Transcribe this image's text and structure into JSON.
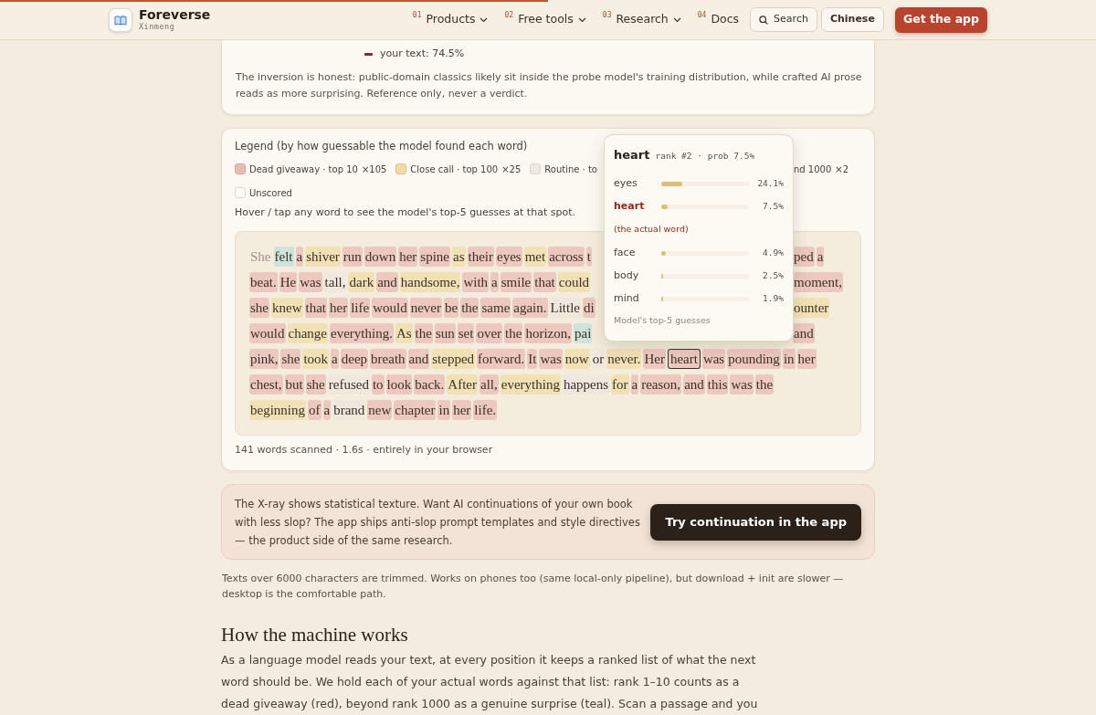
{
  "progress": {
    "level": 0.5
  },
  "header": {
    "brand": {
      "name": "Foreverse",
      "subtitle": "Xinmeng"
    },
    "nav": [
      {
        "number": "01",
        "label": "Products",
        "dropdown": true
      },
      {
        "number": "02",
        "label": "Free tools",
        "dropdown": true
      },
      {
        "number": "03",
        "label": "Research",
        "dropdown": true
      },
      {
        "number": "04",
        "label": "Docs",
        "dropdown": false
      }
    ],
    "search": "Search",
    "language": "Chinese",
    "cta": "Get the app"
  },
  "summary": {
    "series_label": "your text: 74.5%",
    "note": "The inversion is honest: public-domain classics likely sit inside the probe model's training distribution, while crafted AI prose reads as more surprising. Reference only, never a verdict."
  },
  "xray": {
    "legend_title": "Legend (by how guessable the model found each word)",
    "legend_left": [
      {
        "kind": "giveaway",
        "label": "Dead giveaway · top 10",
        "count": "×105"
      },
      {
        "kind": "close",
        "label": "Close call · top 100",
        "count": "×25"
      },
      {
        "kind": "routine",
        "label": "Routine · to"
      }
    ],
    "legend_right": [
      {
        "label": "nd 1000",
        "count": "×2"
      }
    ],
    "legend_extra": [
      {
        "kind": "unscored",
        "label": "Unscored"
      }
    ],
    "hint": "Hover / tap any word to see the model's top-5 guesses at that spot.",
    "passage": [
      {
        "left": [
          {
            "text": "She",
            "kind": "unscored",
            "selected": false
          },
          {
            "text": "felt",
            "kind": "surprise",
            "selected": false
          },
          {
            "text": "a",
            "kind": "giveaway",
            "selected": false
          },
          {
            "text": "shiver",
            "kind": "close",
            "selected": false
          },
          {
            "text": "run",
            "kind": "giveaway",
            "selected": false
          },
          {
            "text": "down",
            "kind": "giveaway",
            "selected": false
          },
          {
            "text": "her",
            "kind": "giveaway",
            "selected": false
          },
          {
            "text": "spine",
            "kind": "giveaway",
            "selected": false
          },
          {
            "text": "as",
            "kind": "close",
            "selected": false
          },
          {
            "text": "their",
            "kind": "giveaway",
            "selected": false
          },
          {
            "text": "eyes",
            "kind": "giveaway",
            "selected": false
          },
          {
            "text": "met",
            "kind": "close",
            "selected": false
          },
          {
            "text": "across",
            "kind": "giveaway",
            "selected": false
          },
          {
            "text": "t",
            "kind": "giveaway",
            "selected": false
          }
        ],
        "right": [
          {
            "text": "ped",
            "kind": "giveaway",
            "selected": false
          },
          {
            "text": "a",
            "kind": "giveaway",
            "selected": false
          }
        ]
      },
      {
        "left": [
          {
            "text": "beat.",
            "kind": "giveaway",
            "selected": false
          },
          {
            "text": "He",
            "kind": "giveaway",
            "selected": false
          },
          {
            "text": "was",
            "kind": "giveaway",
            "selected": false
          },
          {
            "text": "tall,",
            "kind": "routine",
            "selected": false
          },
          {
            "text": "dark",
            "kind": "close",
            "selected": false
          },
          {
            "text": "and",
            "kind": "giveaway",
            "selected": false
          },
          {
            "text": "handsome,",
            "kind": "close",
            "selected": false
          },
          {
            "text": "with",
            "kind": "giveaway",
            "selected": false
          },
          {
            "text": "a",
            "kind": "giveaway",
            "selected": false
          },
          {
            "text": "smile",
            "kind": "giveaway",
            "selected": false
          },
          {
            "text": "that",
            "kind": "giveaway",
            "selected": false
          },
          {
            "text": "could",
            "kind": "close",
            "selected": false
          }
        ],
        "right": [
          {
            "text": "moment,",
            "kind": "giveaway",
            "selected": false
          }
        ]
      },
      {
        "left": [
          {
            "text": "she",
            "kind": "giveaway",
            "selected": false
          },
          {
            "text": "knew",
            "kind": "close",
            "selected": false
          },
          {
            "text": "that",
            "kind": "giveaway",
            "selected": false
          },
          {
            "text": "her",
            "kind": "giveaway",
            "selected": false
          },
          {
            "text": "life",
            "kind": "giveaway",
            "selected": false
          },
          {
            "text": "would",
            "kind": "giveaway",
            "selected": false
          },
          {
            "text": "never",
            "kind": "giveaway",
            "selected": false
          },
          {
            "text": "be",
            "kind": "giveaway",
            "selected": false
          },
          {
            "text": "the",
            "kind": "giveaway",
            "selected": false
          },
          {
            "text": "same",
            "kind": "giveaway",
            "selected": false
          },
          {
            "text": "again.",
            "kind": "giveaway",
            "selected": false
          },
          {
            "text": "Little",
            "kind": "routine",
            "selected": false
          },
          {
            "text": "di",
            "kind": "giveaway",
            "selected": false
          }
        ],
        "right": [
          {
            "text": "ounter",
            "kind": "close",
            "selected": false
          }
        ]
      },
      {
        "left": [
          {
            "text": "would",
            "kind": "giveaway",
            "selected": false
          },
          {
            "text": "change",
            "kind": "close",
            "selected": false
          },
          {
            "text": "everything.",
            "kind": "giveaway",
            "selected": false
          },
          {
            "text": "As",
            "kind": "close",
            "selected": false
          },
          {
            "text": "the",
            "kind": "giveaway",
            "selected": false
          },
          {
            "text": "sun",
            "kind": "giveaway",
            "selected": false
          },
          {
            "text": "set",
            "kind": "giveaway",
            "selected": false
          },
          {
            "text": "over",
            "kind": "giveaway",
            "selected": false
          },
          {
            "text": "the",
            "kind": "giveaway",
            "selected": false
          },
          {
            "text": "horizon,",
            "kind": "giveaway",
            "selected": false
          },
          {
            "text": "pai",
            "kind": "surprise",
            "selected": false
          }
        ],
        "right": [
          {
            "text": "and",
            "kind": "giveaway",
            "selected": false
          }
        ]
      },
      {
        "left": [
          {
            "text": "pink,",
            "kind": "giveaway",
            "selected": false
          },
          {
            "text": "she",
            "kind": "giveaway",
            "selected": false
          },
          {
            "text": "took",
            "kind": "close",
            "selected": false
          },
          {
            "text": "a",
            "kind": "giveaway",
            "selected": false
          },
          {
            "text": "deep",
            "kind": "giveaway",
            "selected": false
          },
          {
            "text": "breath",
            "kind": "giveaway",
            "selected": false
          },
          {
            "text": "and",
            "kind": "giveaway",
            "selected": false
          },
          {
            "text": "stepped",
            "kind": "close",
            "selected": false
          },
          {
            "text": "forward.",
            "kind": "giveaway",
            "selected": false
          },
          {
            "text": "It",
            "kind": "giveaway",
            "selected": false
          },
          {
            "text": "was",
            "kind": "giveaway",
            "selected": false
          },
          {
            "text": "now",
            "kind": "close",
            "selected": false
          },
          {
            "text": "or",
            "kind": "routine",
            "selected": false
          },
          {
            "text": "never.",
            "kind": "close",
            "selected": false
          },
          {
            "text": "Her",
            "kind": "giveaway",
            "selected": false
          },
          {
            "text": "heart",
            "kind": "giveaway",
            "selected": true
          },
          {
            "text": "was",
            "kind": "giveaway",
            "selected": false
          },
          {
            "text": "pounding",
            "kind": "giveaway",
            "selected": false
          },
          {
            "text": "in",
            "kind": "giveaway",
            "selected": false
          },
          {
            "text": "her",
            "kind": "giveaway",
            "selected": false
          }
        ]
      },
      {
        "left": [
          {
            "text": "chest,",
            "kind": "giveaway",
            "selected": false
          },
          {
            "text": "but",
            "kind": "giveaway",
            "selected": false
          },
          {
            "text": "she",
            "kind": "giveaway",
            "selected": false
          },
          {
            "text": "refused",
            "kind": "routine",
            "selected": false
          },
          {
            "text": "to",
            "kind": "giveaway",
            "selected": false
          },
          {
            "text": "look",
            "kind": "giveaway",
            "selected": false
          },
          {
            "text": "back.",
            "kind": "giveaway",
            "selected": false
          },
          {
            "text": "After",
            "kind": "close",
            "selected": false
          },
          {
            "text": "all,",
            "kind": "giveaway",
            "selected": false
          },
          {
            "text": "everything",
            "kind": "close",
            "selected": false
          },
          {
            "text": "happens",
            "kind": "routine",
            "selected": false
          },
          {
            "text": "for",
            "kind": "close",
            "selected": false
          },
          {
            "text": "a",
            "kind": "giveaway",
            "selected": false
          },
          {
            "text": "reason,",
            "kind": "giveaway",
            "selected": false
          },
          {
            "text": "and",
            "kind": "giveaway",
            "selected": false
          },
          {
            "text": "this",
            "kind": "giveaway",
            "selected": false
          },
          {
            "text": "was",
            "kind": "giveaway",
            "selected": false
          },
          {
            "text": "the",
            "kind": "giveaway",
            "selected": false
          }
        ]
      },
      {
        "left": [
          {
            "text": "beginning",
            "kind": "close",
            "selected": false
          },
          {
            "text": "of",
            "kind": "giveaway",
            "selected": false
          },
          {
            "text": "a",
            "kind": "giveaway",
            "selected": false
          },
          {
            "text": "brand",
            "kind": "routine",
            "selected": false
          },
          {
            "text": "new",
            "kind": "giveaway",
            "selected": false
          },
          {
            "text": "chapter",
            "kind": "giveaway",
            "selected": false
          },
          {
            "text": "in",
            "kind": "giveaway",
            "selected": false
          },
          {
            "text": "her",
            "kind": "giveaway",
            "selected": false
          },
          {
            "text": "life.",
            "kind": "giveaway",
            "selected": false
          }
        ]
      }
    ],
    "tooltip": {
      "word": "heart",
      "meta": "rank #2 · prob 7.5%",
      "guesses": [
        {
          "word": "eyes",
          "level": 0.241,
          "reading": "24.1%",
          "actual": false
        },
        {
          "word": "heart",
          "level": 0.075,
          "reading": "7.5%",
          "actual": true,
          "note": "(the actual word)"
        },
        {
          "word": "face",
          "level": 0.049,
          "reading": "4.9%",
          "actual": false
        },
        {
          "word": "body",
          "level": 0.025,
          "reading": "2.5%",
          "actual": false
        },
        {
          "word": "mind",
          "level": 0.019,
          "reading": "1.9%",
          "actual": false
        }
      ],
      "footer": "Model's top-5 guesses"
    },
    "stats": "141 words scanned · 1.6s · entirely in your browser"
  },
  "promo": {
    "text": "The X-ray shows statistical texture. Want AI continuations of your own book with less slop? The app ships anti-slop prompt templates and style directives — the product side of the same research.",
    "button": "Try continuation in the app"
  },
  "limits_note": "Texts over 6000 characters are trimmed. Works on phones too (same local-only pipeline), but download + init are slower — desktop is the comfortable path.",
  "section": {
    "heading": "How the machine works",
    "body": "As a language model reads your text, at every position it keeps a ranked list of what the next word should be. We hold each of your actual words against that list: rank 1–10 counts as a dead giveaway (red), beyond rank 1000 as a genuine surprise (teal). Scan a passage and you"
  }
}
